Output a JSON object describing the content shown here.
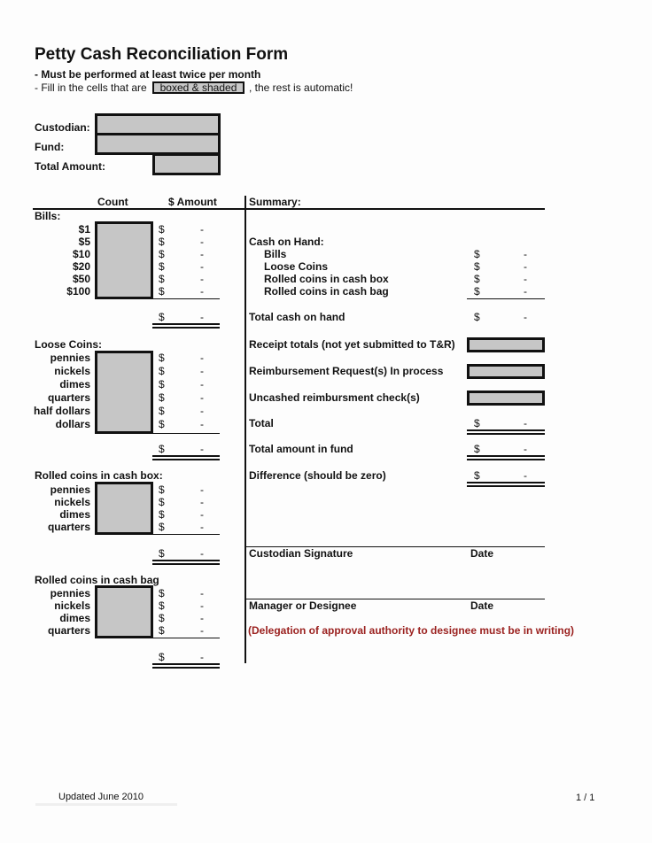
{
  "header": {
    "title": "Petty Cash Reconciliation Form",
    "note1": "- Must be performed at least twice per month",
    "note2_prefix": "- Fill in the cells that are",
    "note2_box": "boxed & shaded",
    "note2_suffix": ", the rest is automatic!"
  },
  "info": {
    "custodian_label": "Custodian:",
    "fund_label": "Fund:",
    "total_amount_label": "Total Amount:",
    "custodian_value": "",
    "fund_value": "",
    "total_amount_value": ""
  },
  "columns": {
    "count": "Count",
    "amount": "$ Amount",
    "summary": "Summary:"
  },
  "currency_symbol": "$",
  "empty_value": "-",
  "sections": {
    "bills": {
      "label": "Bills:",
      "rows": [
        "$1",
        "$5",
        "$10",
        "$20",
        "$50",
        "$100"
      ]
    },
    "loose": {
      "label": "Loose Coins:",
      "rows": [
        "pennies",
        "nickels",
        "dimes",
        "quarters",
        "half dollars",
        "dollars"
      ]
    },
    "rolled_box": {
      "label": "Rolled coins in cash box:",
      "rows": [
        "pennies",
        "nickels",
        "dimes",
        "quarters"
      ]
    },
    "rolled_bag": {
      "label": "Rolled coins in cash bag",
      "rows": [
        "pennies",
        "nickels",
        "dimes",
        "quarters"
      ]
    }
  },
  "summary": {
    "cash_on_hand": "Cash on Hand:",
    "items": [
      "Bills",
      "Loose Coins",
      "Rolled coins in cash box",
      "Rolled coins in cash bag"
    ],
    "total_cash": "Total cash on hand",
    "receipt_totals": "Receipt totals (not yet submitted to T&R)",
    "reimbursement": "Reimbursement Request(s) In process",
    "uncashed": "Uncashed reimbursment check(s)",
    "total": "Total",
    "total_fund": "Total amount in fund",
    "difference": "Difference (should be zero)",
    "custodian_signature": "Custodian Signature",
    "date": "Date",
    "manager": "Manager or Designee",
    "delegation_note": "(Delegation of approval authority to designee must be in writing)"
  },
  "footer": {
    "updated": "Updated June 2010",
    "page": "1 / 1"
  },
  "colors": {
    "shade": "#c6c6c6",
    "note_red": "#9b2220"
  }
}
